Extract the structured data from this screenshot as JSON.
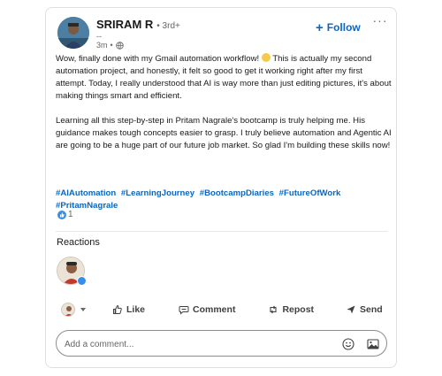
{
  "post": {
    "author": {
      "name": "SRIRAM R",
      "degree": "• 3rd+",
      "subtitle": "--",
      "time": "3m",
      "visibility_icon": "globe-icon"
    },
    "follow_label": "Follow",
    "more_icon": "ellipsis-icon",
    "text_part1": "Wow, finally done with my Gmail automation workflow! ",
    "text_part2": " This is actually my second automation project, and honestly, it felt so good to get it working right after my first attempt. Today, I really understood that AI is way more than just editing pictures, it's about making things smart and efficient.\n\nLearning all this step-by-step in Pritam Nagrale's bootcamp is truly helping me. His guidance makes tough concepts easier to grasp. I truly believe automation and Agentic AI are going to be a huge part of our future job market. So glad I'm building these skills now!",
    "hashtags": [
      "#AIAutomation",
      "#LearningJourney",
      "#BootcampDiaries",
      "#FutureOfWork",
      "#PritamNagrale"
    ],
    "reaction_count": "1"
  },
  "reactions": {
    "heading": "Reactions"
  },
  "actions": {
    "like": "Like",
    "comment": "Comment",
    "repost": "Repost",
    "send": "Send"
  },
  "comment_box": {
    "placeholder": "Add a comment..."
  },
  "colors": {
    "accent": "#0a66c2",
    "like_badge": "#378fe9"
  }
}
